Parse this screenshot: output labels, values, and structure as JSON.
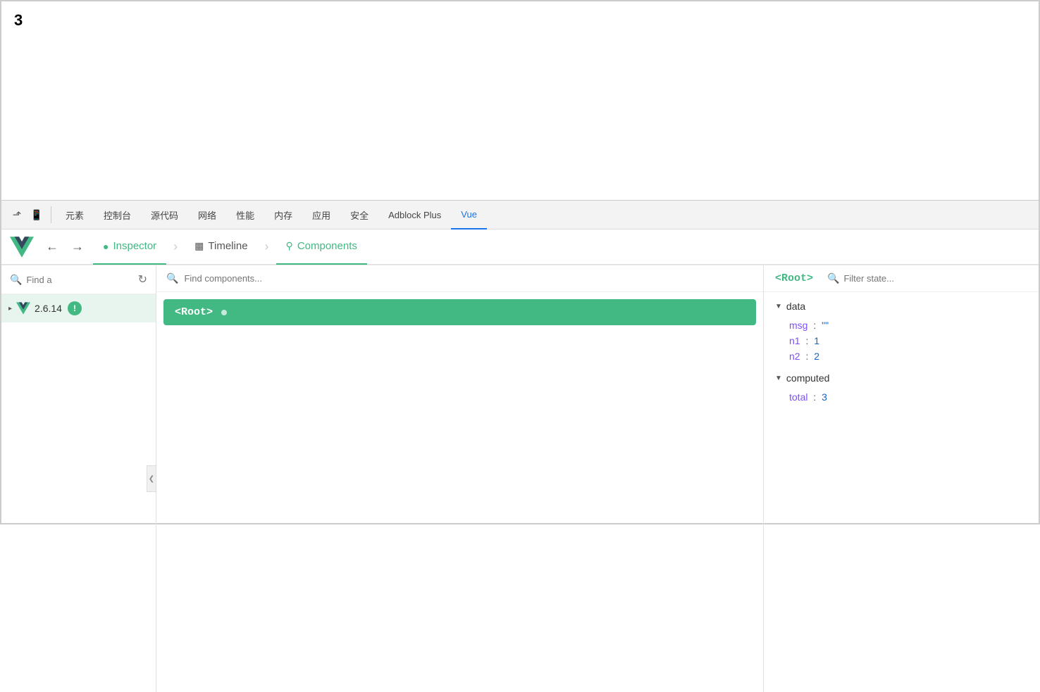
{
  "page": {
    "number": "3"
  },
  "devtools": {
    "tabs": [
      {
        "label": "元素",
        "active": false
      },
      {
        "label": "控制台",
        "active": false
      },
      {
        "label": "源代码",
        "active": false
      },
      {
        "label": "网络",
        "active": false
      },
      {
        "label": "性能",
        "active": false
      },
      {
        "label": "内存",
        "active": false
      },
      {
        "label": "应用",
        "active": false
      },
      {
        "label": "安全",
        "active": false
      },
      {
        "label": "Adblock Plus",
        "active": false
      },
      {
        "label": "Vue",
        "active": true
      }
    ]
  },
  "vue_toolbar": {
    "back_label": "←",
    "forward_label": "→",
    "tabs": [
      {
        "id": "inspector",
        "label": "Inspector",
        "icon": "⬤",
        "active": true
      },
      {
        "id": "timeline",
        "label": "Timeline",
        "icon": "▦",
        "active": false
      },
      {
        "id": "components",
        "label": "Components",
        "icon": "⚇",
        "active": false
      }
    ],
    "separator": "›"
  },
  "sidebar": {
    "search_placeholder": "Find a",
    "version": "2.6.14",
    "warning_icon": "!"
  },
  "component_panel": {
    "search_placeholder": "Find components...",
    "selected_component": "<Root>",
    "dot_visible": true
  },
  "state_panel": {
    "root_label": "<Root>",
    "filter_placeholder": "Filter state...",
    "sections": [
      {
        "name": "data",
        "expanded": true,
        "rows": [
          {
            "key": "msg",
            "colon": ":",
            "value": "\"\""
          },
          {
            "key": "n1",
            "colon": ":",
            "value": "1"
          },
          {
            "key": "n2",
            "colon": ":",
            "value": "2"
          }
        ]
      },
      {
        "name": "computed",
        "expanded": true,
        "rows": [
          {
            "key": "total",
            "colon": ":",
            "value": "3"
          }
        ]
      }
    ]
  }
}
